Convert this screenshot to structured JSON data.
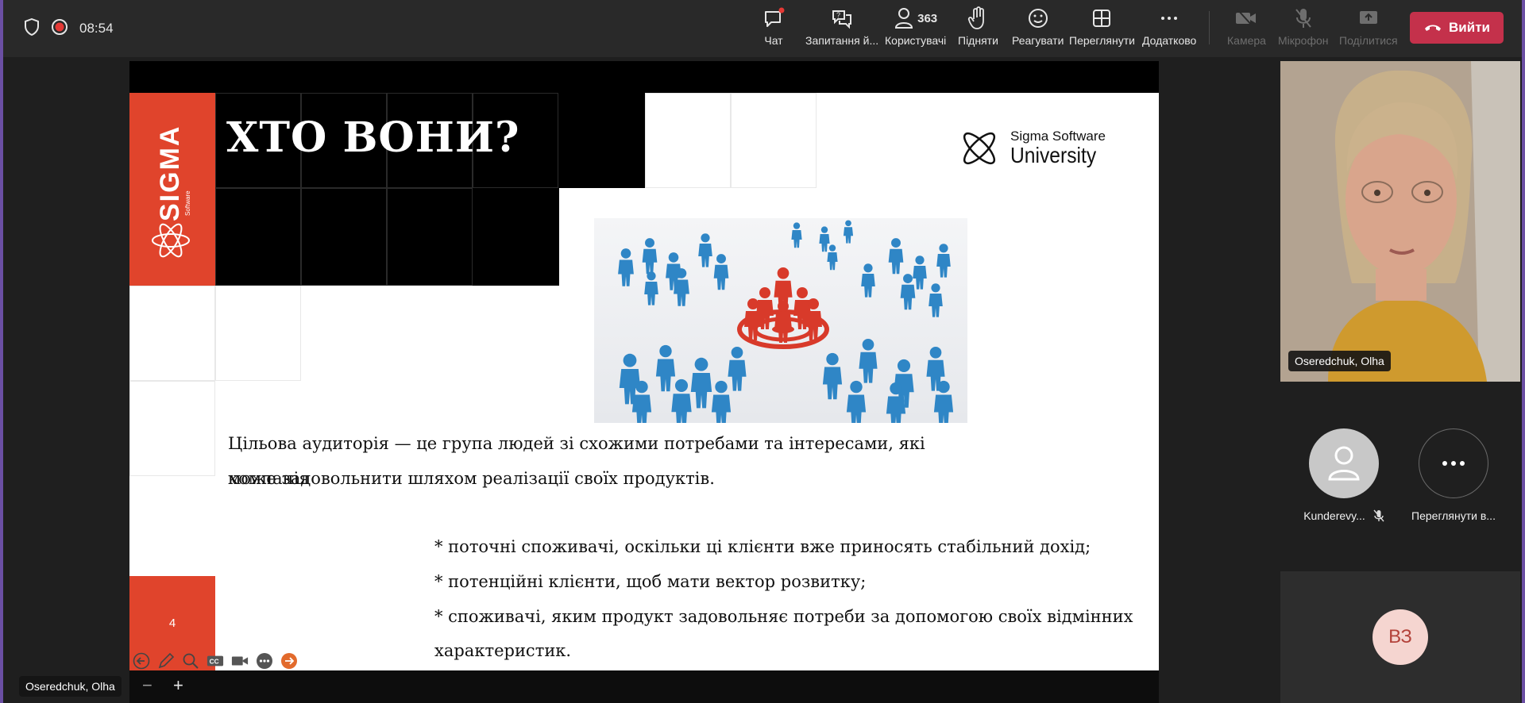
{
  "meeting": {
    "timer": "08:54",
    "toolbar": {
      "chat": "Чат",
      "qa": "Запитання й...",
      "people": "Користувачі",
      "people_count": "363",
      "raise": "Підняти",
      "react": "Реагувати",
      "view": "Переглянути",
      "more": "Додатково",
      "camera": "Камера",
      "mic": "Мікрофон",
      "share": "Поділитися",
      "leave": "Вийти"
    }
  },
  "slide": {
    "title": "ХТО ВОНИ?",
    "logo_text": "SIGMA",
    "logo_sub": "Software",
    "brand_line1": "Sigma Software",
    "brand_line2": "University",
    "paragraph_line1": "Цільова аудиторія — це група людей зі схожими потребами та інтересами, які компанія",
    "paragraph_line2": "може задовольнити шляхом реалізації своїх продуктів.",
    "bullets": [
      "* поточні споживачі, оскільки ці клієнти вже приносять стабільний дохід;",
      "* потенційні клієнти, щоб мати вектор розвитку;",
      "* споживачі, яким продукт задовольняє потреби за допомогою своїх відмінних",
      "характеристик."
    ],
    "page_number": "4"
  },
  "presenter_label": "Oseredchuk, Olha",
  "zoom": {
    "minus": "−",
    "plus": "+"
  },
  "participants": {
    "video_name": "Oseredchuk, Olha",
    "p1": "Kunderevy...",
    "more": "Переглянути в...",
    "initials": "ВЗ"
  },
  "colors": {
    "accent_red": "#e0442c",
    "leave_red": "#c4314b",
    "figure_blue": "#2f86c6",
    "figure_red": "#d83a2a"
  }
}
